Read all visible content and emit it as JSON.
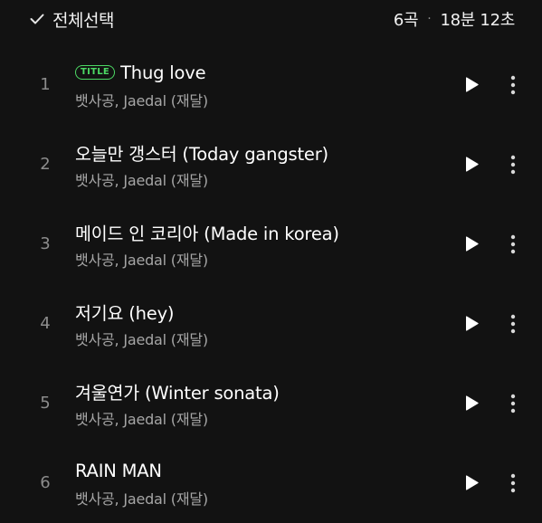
{
  "header": {
    "select_all_label": "전체선택",
    "track_count": "6곡",
    "separator": "·",
    "total_duration": "18분 12초"
  },
  "colors": {
    "background": "#121212",
    "title_badge": "#4cd964",
    "secondary_text": "#a6a6a6"
  },
  "icons": {
    "select_all": "check-icon",
    "play": "play-icon",
    "more": "more-vertical-icon"
  },
  "tracks": [
    {
      "number": "1",
      "badge": "TITLE",
      "title": "Thug love",
      "artist": "뱃사공, Jaedal (재달)"
    },
    {
      "number": "2",
      "title": "오늘만 갱스터 (Today gangster)",
      "artist": "뱃사공, Jaedal (재달)"
    },
    {
      "number": "3",
      "title": "메이드 인 코리아 (Made in korea)",
      "artist": "뱃사공, Jaedal (재달)"
    },
    {
      "number": "4",
      "title": "저기요 (hey)",
      "artist": "뱃사공, Jaedal (재달)"
    },
    {
      "number": "5",
      "title": "겨울연가 (Winter sonata)",
      "artist": "뱃사공, Jaedal (재달)"
    },
    {
      "number": "6",
      "title": "RAIN MAN",
      "artist": "뱃사공, Jaedal (재달)"
    }
  ]
}
